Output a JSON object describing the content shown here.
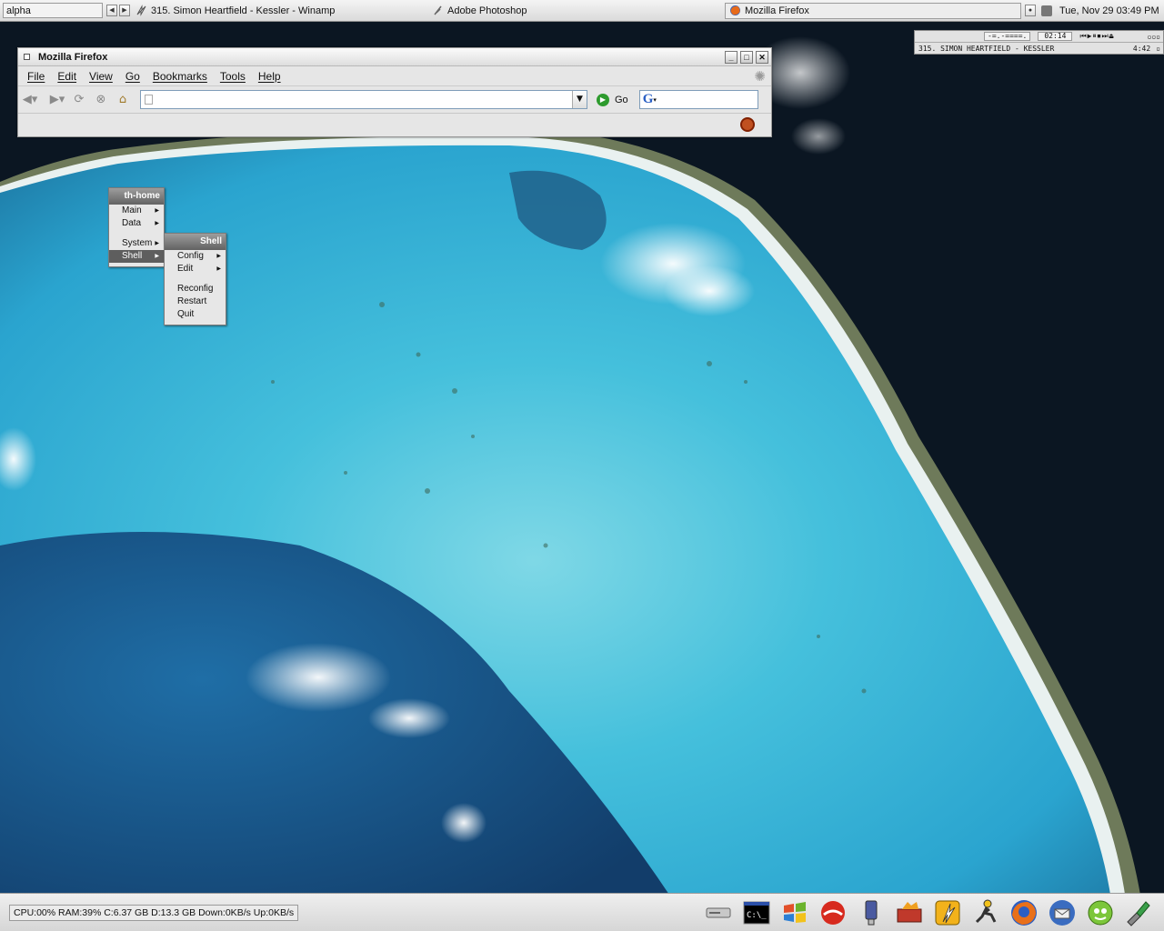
{
  "colors": {
    "accent": "#5e5e5e",
    "menu_header": "#7a7a7a",
    "desktop_water": "#3ab7d6"
  },
  "topbar": {
    "workspace": "alpha",
    "tasks": [
      {
        "label": "315. Simon Heartfield - Kessler - Winamp",
        "icon": "winamp-lightning-icon"
      },
      {
        "label": "Adobe Photoshop",
        "icon": "photoshop-feather-icon"
      },
      {
        "label": "Mozilla Firefox",
        "icon": "firefox-icon"
      }
    ],
    "clock": "Tue, Nov 29 03:49 PM"
  },
  "winamp": {
    "time": "02:14",
    "track": "315. SIMON HEARTFIELD - KESSLER",
    "length": "4:42",
    "vis": "-=.-====."
  },
  "firefox": {
    "title": "Mozilla Firefox",
    "menu": [
      "File",
      "Edit",
      "View",
      "Go",
      "Bookmarks",
      "Tools",
      "Help"
    ],
    "url": "",
    "go_label": "Go",
    "search_engine_icon": "google-icon"
  },
  "menu_main": {
    "title": "th-home",
    "items": [
      "Main",
      "Data",
      "System",
      "Shell"
    ],
    "selected": "Shell"
  },
  "menu_shell": {
    "title": "Shell",
    "items": [
      "Config",
      "Edit",
      "Reconfig",
      "Restart",
      "Quit"
    ]
  },
  "bottombar": {
    "sysinfo": "CPU:00% RAM:39% C:6.37 GB D:13.3 GB Down:0KB/s Up:0KB/s",
    "tray": [
      "drive-icon",
      "command-prompt-icon",
      "windows-flag-icon",
      "redhat-icon",
      "usb-drive-icon",
      "toolbox-icon",
      "winamp-icon",
      "aim-runner-icon",
      "firefox-icon",
      "thunderbird-icon",
      "messenger-icon",
      "network-tools-icon"
    ]
  }
}
